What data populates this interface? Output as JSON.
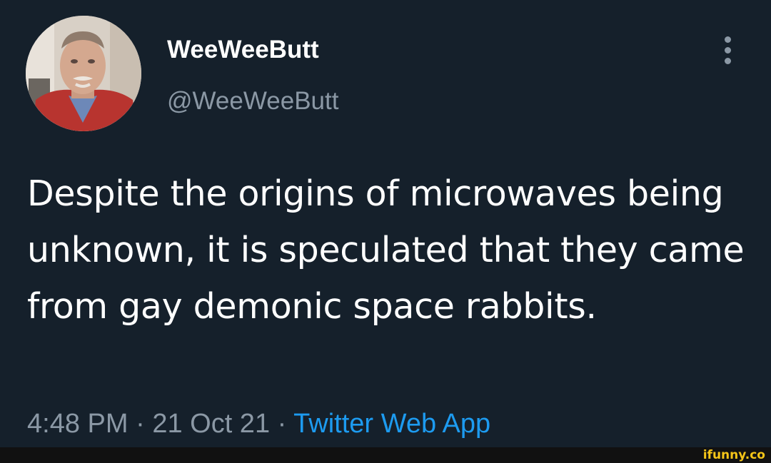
{
  "tweet": {
    "display_name": "WeeWeeButt",
    "handle": "@WeeWeeButt",
    "text": "Despite the origins of microwaves being unknown, it is speculated that they came from gay demonic space rabbits.",
    "time": "4:48 PM",
    "date": "21 Oct 21",
    "separator": "·",
    "source_app": "Twitter Web App",
    "avatar": "profile-photo",
    "menu_icon": "more-vertical-icon"
  },
  "watermark": {
    "text": "ifunny.co"
  },
  "colors": {
    "background": "#15202b",
    "text_primary": "#ffffff",
    "text_secondary": "#8b98a5",
    "link": "#1d9bf0",
    "watermark": "#f5c518",
    "footer": "#111111"
  }
}
